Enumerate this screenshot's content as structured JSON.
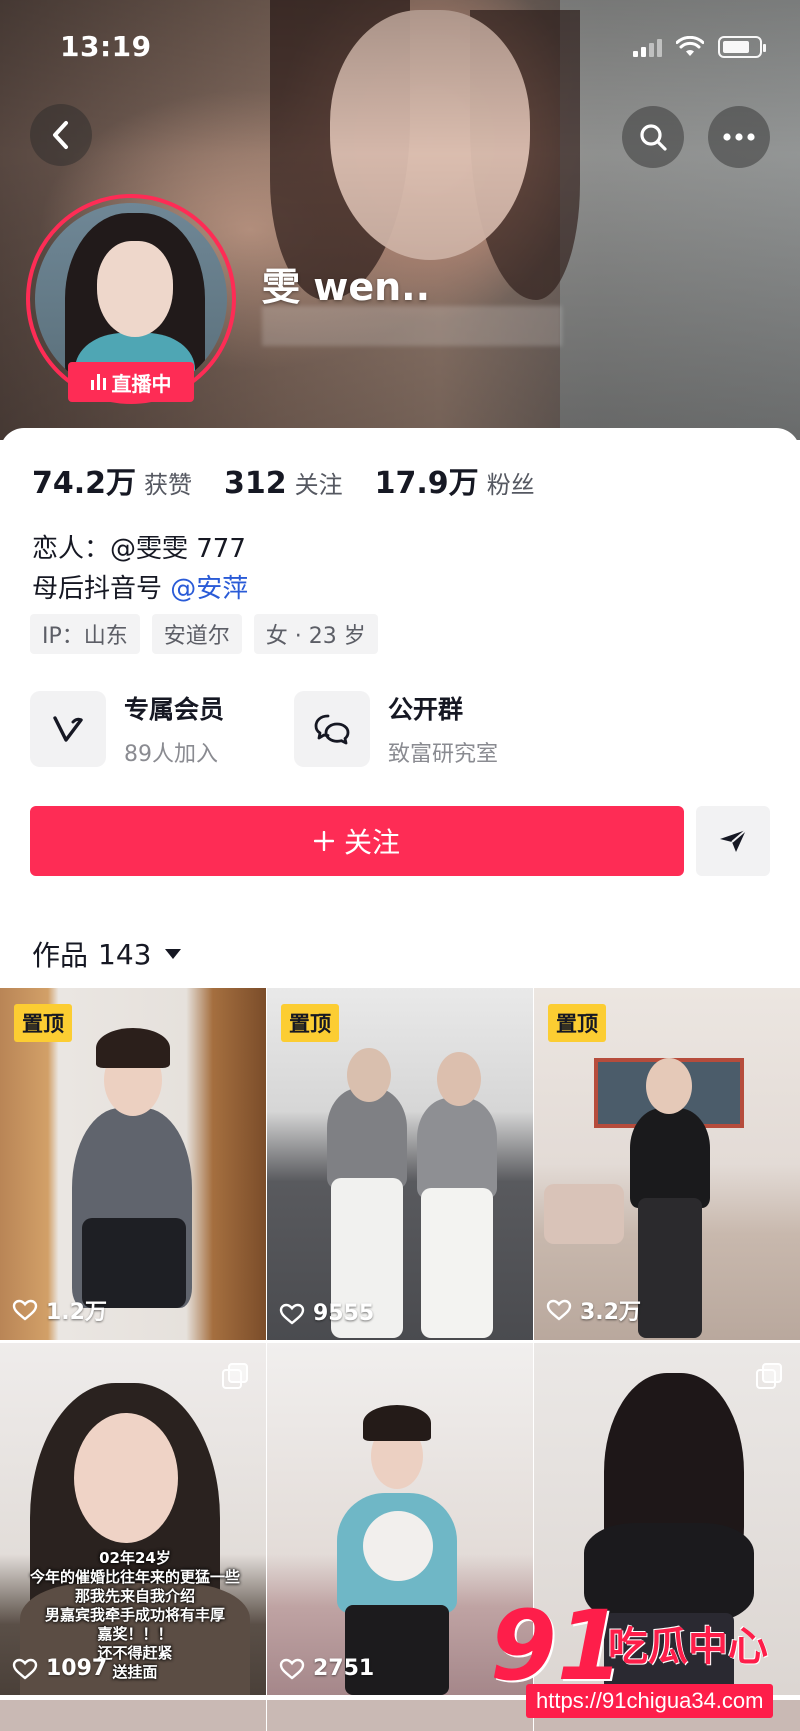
{
  "status_bar": {
    "time": "13:19"
  },
  "profile": {
    "nickname": "雯 wen..",
    "live_badge": "直播中"
  },
  "stats": [
    {
      "value": "74.2万",
      "label": "获赞"
    },
    {
      "value": "312",
      "label": "关注"
    },
    {
      "value": "17.9万",
      "label": "粉丝"
    }
  ],
  "bio": {
    "line1": "恋人：@雯雯 777",
    "line2_prefix": "母后抖音号 ",
    "line2_mention": "@安萍"
  },
  "tags": [
    "IP：山东",
    "安道尔",
    "女 · 23 岁"
  ],
  "features": {
    "member": {
      "title": "专属会员",
      "subtitle": "89人加入",
      "icon": "v-icon"
    },
    "group": {
      "title": "公开群",
      "subtitle": "致富研究室",
      "icon": "chat-bubbles-icon"
    }
  },
  "actions": {
    "follow_label": "关注",
    "share_icon": "send-icon"
  },
  "works_tab": {
    "label": "作品",
    "count": "143"
  },
  "videos": [
    {
      "pinned": true,
      "pin_label": "置顶",
      "likes": "1.2万",
      "multi": false
    },
    {
      "pinned": true,
      "pin_label": "置顶",
      "likes": "9555",
      "multi": false
    },
    {
      "pinned": true,
      "pin_label": "置顶",
      "likes": "3.2万",
      "multi": false
    },
    {
      "pinned": false,
      "likes": "1097",
      "multi": true,
      "caption": "02年24岁\n今年的催婚比往年来的更猛一些\n那我先来自我介绍\n男嘉宾我牵手成功将有丰厚\n嘉奖！！！\n还不得赶紧\n送挂面"
    },
    {
      "pinned": false,
      "likes": "2751",
      "multi": false
    },
    {
      "pinned": false,
      "likes": "",
      "multi": true
    }
  ],
  "watermark": {
    "number": "91",
    "brand": "吃瓜中心",
    "url": "https://91chigua34.com"
  },
  "colors": {
    "accent": "#fe2c55",
    "pin": "#fccd32",
    "mention": "#2a5bd7"
  }
}
